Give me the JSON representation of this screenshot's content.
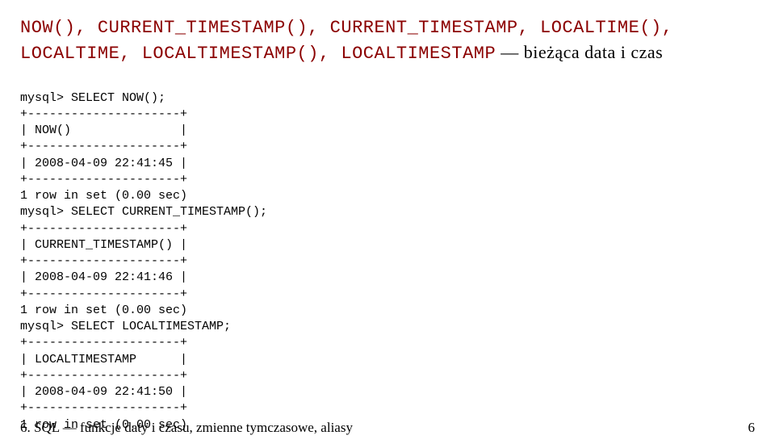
{
  "title": {
    "funcs": "NOW(), CURRENT_TIMESTAMP(), CURRENT_TIMESTAMP, LOCALTIME(), LOCALTIME, LOCALTIMESTAMP(), LOCALTIMESTAMP",
    "desc": " — bieżąca data i czas"
  },
  "code": {
    "l01": "mysql> SELECT NOW();",
    "l02": "+---------------------+",
    "l03": "| NOW()               |",
    "l04": "+---------------------+",
    "l05": "| 2008-04-09 22:41:45 |",
    "l06": "+---------------------+",
    "l07": "1 row in set (0.00 sec)",
    "l08": "mysql> SELECT CURRENT_TIMESTAMP();",
    "l09": "+---------------------+",
    "l10": "| CURRENT_TIMESTAMP() |",
    "l11": "+---------------------+",
    "l12": "| 2008-04-09 22:41:46 |",
    "l13": "+---------------------+",
    "l14": "1 row in set (0.00 sec)",
    "l15": "mysql> SELECT LOCALTIMESTAMP;",
    "l16": "+---------------------+",
    "l17": "| LOCALTIMESTAMP      |",
    "l18": "+---------------------+",
    "l19": "| 2008-04-09 22:41:50 |",
    "l20": "+---------------------+",
    "l21": "1 row in set (0.00 sec)"
  },
  "footer": {
    "left": "6. SQL — funkcje daty i czasu, zmienne tymczasowe, aliasy",
    "right": "6"
  }
}
